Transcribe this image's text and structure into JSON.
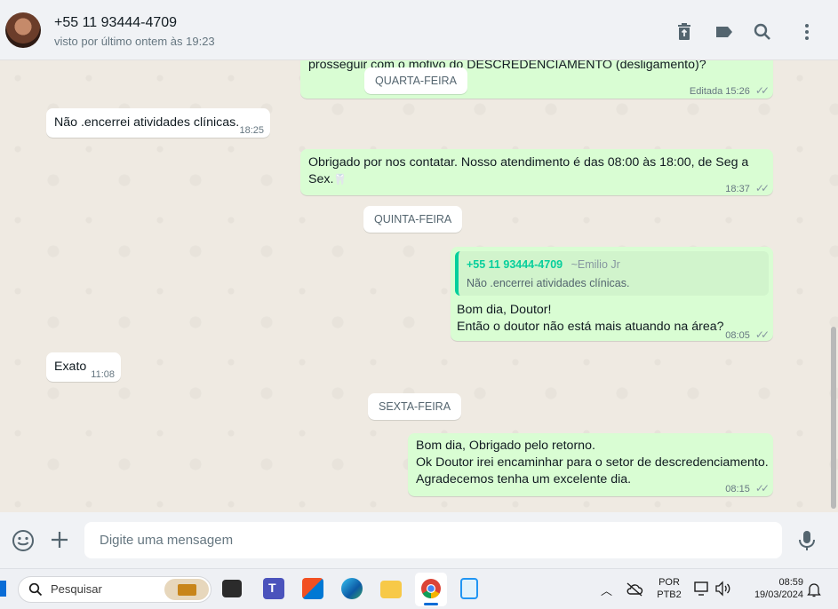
{
  "header": {
    "contact_name": "+55 11 93444-4709",
    "last_seen": "visto por último ontem às 19:23",
    "icons": [
      "delete-icon",
      "label-icon",
      "search-icon",
      "menu-icon"
    ]
  },
  "messages": {
    "m1": {
      "text": "prosseguir com o motivo do DESCREDENCIAMENTO (desligamento)?",
      "edited": "Editada",
      "time": "15:26"
    },
    "day1": "QUARTA-FEIRA",
    "m2": {
      "text": "Não .encerrei atividades clínicas.",
      "time": "18:25"
    },
    "m3": {
      "line1": "Obrigado por nos contatar. Nosso atendimento é das 08:00 às 18:00, de Seg a",
      "line2": "Sex.",
      "emoji": "🦷",
      "time": "18:37"
    },
    "day2": "QUINTA-FEIRA",
    "m4": {
      "quote_author": "+55 11 93444-4709",
      "quote_alias": "~Emilio Jr",
      "quote_text": "Não .encerrei atividades clínicas.",
      "line1": "Bom dia, Doutor!",
      "line2": "Então o doutor não está mais atuando na área?",
      "time": "08:05"
    },
    "m5": {
      "text": "Exato",
      "time": "11:08"
    },
    "day3": "SEXTA-FEIRA",
    "m6": {
      "line1": "Bom dia, Obrigado pelo retorno.",
      "line2": "Ok Doutor irei encaminhar para o setor de descredenciamento.",
      "line3": "Agradecemos tenha um excelente dia.",
      "time": "08:15"
    }
  },
  "composer": {
    "placeholder": "Digite uma mensagem",
    "icons": [
      "emoji-icon",
      "attach-plus-icon",
      "microphone-icon"
    ]
  },
  "taskbar": {
    "search_label": "Pesquisar",
    "apps": [
      "file-explorer-icon",
      "teams-icon",
      "store-icon",
      "edge-icon",
      "folder-icon",
      "chrome-icon",
      "notepad-icon"
    ],
    "language": "POR",
    "layout": "PTB2",
    "time": "08:59",
    "date": "19/03/2024"
  },
  "colors": {
    "outgoing_bubble": "#d9fdd3",
    "incoming_bubble": "#ffffff",
    "chat_background": "#efeae2",
    "quote_accent": "#06cf9c"
  }
}
